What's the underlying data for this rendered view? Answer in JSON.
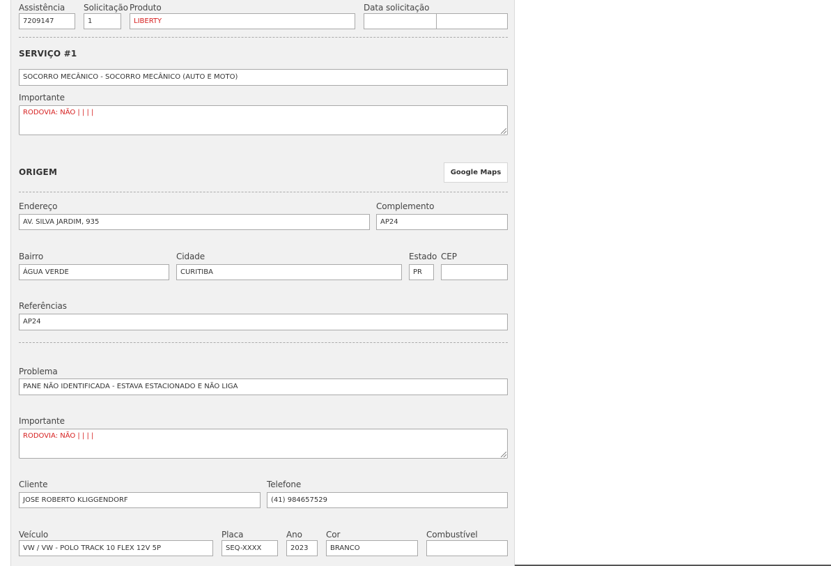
{
  "top": {
    "assistencia": {
      "label": "Assistência",
      "value": "7209147"
    },
    "solicitacao": {
      "label": "Solicitação",
      "value": "1"
    },
    "produto": {
      "label": "Produto",
      "value": "LIBERTY"
    },
    "data_solicitacao": {
      "label": "Data solicitação",
      "value_date": "",
      "value_time": ""
    }
  },
  "servico": {
    "title": "SERVIÇO #1",
    "name": "SOCORRO MECÂNICO - SOCORRO MECÂNICO (AUTO E MOTO)",
    "importante_label": "Importante",
    "importante_value": "RODOVIA: NÃO |  |   |   |"
  },
  "origem": {
    "title": "ORIGEM",
    "maps_button": "Google Maps",
    "endereco": {
      "label": "Endereço",
      "value": "AV. SILVA JARDIM, 935"
    },
    "complemento": {
      "label": "Complemento",
      "value": "AP24"
    },
    "bairro": {
      "label": "Bairro",
      "value": "ÁGUA VERDE"
    },
    "cidade": {
      "label": "Cidade",
      "value": "CURITIBA"
    },
    "estado": {
      "label": "Estado",
      "value": "PR"
    },
    "cep": {
      "label": "CEP",
      "value": ""
    },
    "referencias": {
      "label": "Referências",
      "value": "AP24"
    }
  },
  "problema": {
    "label": "Problema",
    "value": "PANE NÃO IDENTIFICADA - ESTAVA ESTACIONADO E NÃO LIGA",
    "importante_label": "Importante",
    "importante_value": "RODOVIA: NÃO |  |   |   |"
  },
  "cliente": {
    "nome": {
      "label": "Cliente",
      "value": "JOSE ROBERTO KLIGGENDORF"
    },
    "telefone": {
      "label": "Telefone",
      "value": "(41) 984657529"
    }
  },
  "veiculo": {
    "modelo": {
      "label": "Veículo",
      "value": "VW / VW - POLO TRACK 10 FLEX 12V 5P"
    },
    "placa": {
      "label": "Placa",
      "value": "SEQ-XXXX"
    },
    "ano": {
      "label": "Ano",
      "value": "2023"
    },
    "cor": {
      "label": "Cor",
      "value": "BRANCO"
    },
    "combustivel": {
      "label": "Combustível",
      "value": ""
    }
  },
  "colors": {
    "panel": "#f1f1f1",
    "alert_text": "#d61f1f",
    "border": "#a9a9a9"
  }
}
